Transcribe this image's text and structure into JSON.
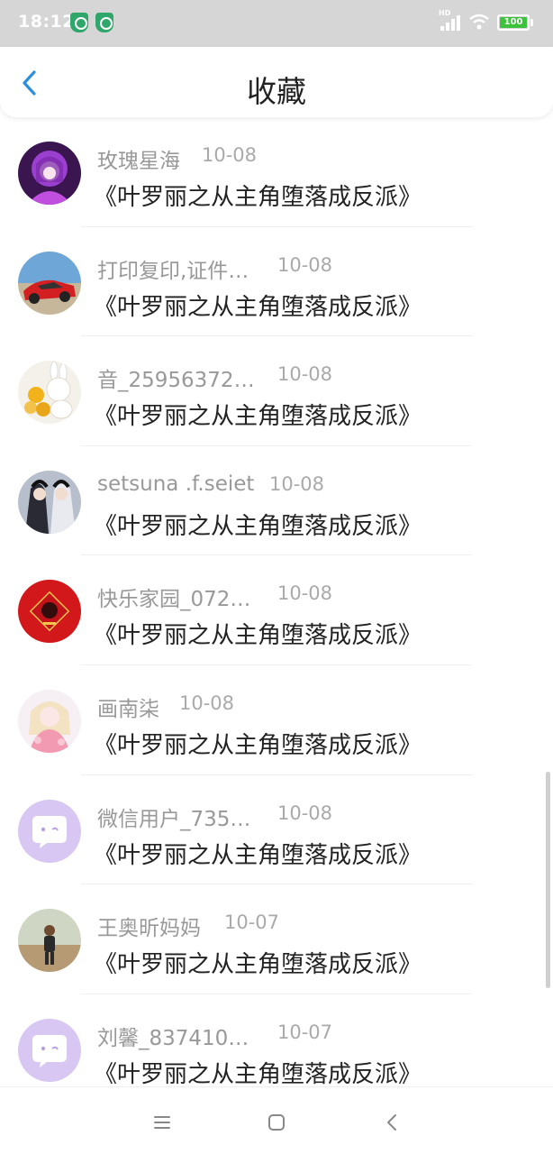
{
  "status_bar": {
    "time": "18:12",
    "network_badge": "HD",
    "battery": "100",
    "icons": [
      "shield-icon",
      "shield-icon",
      "signal-icon",
      "wifi-icon",
      "battery-icon"
    ]
  },
  "header": {
    "title": "收藏",
    "back_icon": "chevron-left-icon"
  },
  "items": [
    {
      "user": "玫瑰星海",
      "date": "10-08",
      "book": "《叶罗丽之从主角堕落成反派》",
      "avatar": "anime-girl-purple"
    },
    {
      "user": "打印复印,证件…",
      "date": "10-08",
      "book": "《叶罗丽之从主角堕落成反派》",
      "avatar": "red-car"
    },
    {
      "user": "音_25956372…",
      "date": "10-08",
      "book": "《叶罗丽之从主角堕落成反派》",
      "avatar": "rabbit-flowers"
    },
    {
      "user": "setsuna .f.seiet",
      "date": "10-08",
      "book": "《叶罗丽之从主角堕落成反派》",
      "avatar": "anime-duo"
    },
    {
      "user": "快乐家园_072…",
      "date": "10-08",
      "book": "《叶罗丽之从主角堕落成反派》",
      "avatar": "fu-red"
    },
    {
      "user": "画南柒",
      "date": "10-08",
      "book": "《叶罗丽之从主角堕落成反派》",
      "avatar": "anime-girl-pink"
    },
    {
      "user": "微信用户_735…",
      "date": "10-08",
      "book": "《叶罗丽之从主角堕落成反派》",
      "avatar": "default-purple"
    },
    {
      "user": "王奥昕妈妈",
      "date": "10-07",
      "book": "《叶罗丽之从主角堕落成反派》",
      "avatar": "child-photo"
    },
    {
      "user": "刘馨_837410…",
      "date": "10-07",
      "book": "《叶罗丽之从主角堕落成反派》",
      "avatar": "default-purple"
    }
  ],
  "nav_bar": {
    "icons": [
      "menu-icon",
      "home-icon",
      "back-icon"
    ]
  },
  "colors": {
    "status_bar_bg": "#d6d6d6",
    "accent": "#2b8fde",
    "name_text": "#999999",
    "book_text": "#222222",
    "battery_green": "#3cc23c",
    "default_avatar": "#d8c7f2"
  }
}
